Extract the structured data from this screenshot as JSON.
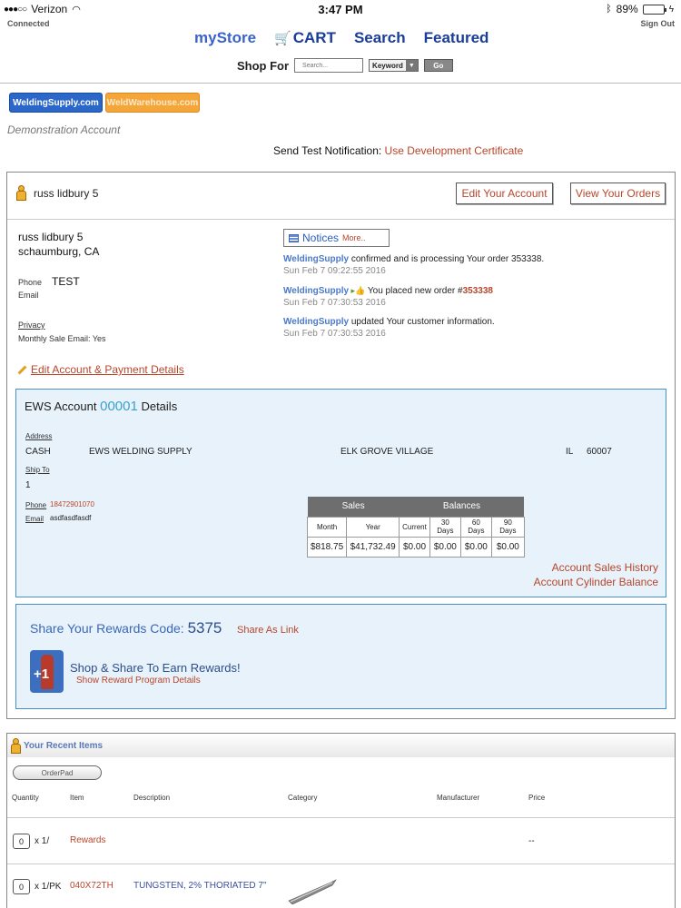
{
  "status": {
    "carrier": "Verizon",
    "time": "3:47 PM",
    "battery": "89%",
    "battery_level": 0.89
  },
  "header": {
    "connected": "Connected",
    "sign_out": "Sign Out",
    "nav": {
      "mystore": "myStore",
      "cart": "CART",
      "search": "Search",
      "featured": "Featured"
    },
    "shop_for": "Shop For",
    "search_placeholder": "Search...",
    "keyword": "Keyword",
    "go": "Go"
  },
  "stores": {
    "tab1": "WeldingSupply.com",
    "tab2": "WeldWarehouse.com"
  },
  "demo_account": "Demonstration Account",
  "send_test": {
    "label": "Send Test",
    "notification": "Notification:",
    "link": "Use Development Certificate"
  },
  "account": {
    "user_name": "russ lidbury 5",
    "edit_account": "Edit Your Account",
    "view_orders": "View Your Orders",
    "name": "russ lidbury 5",
    "location": "schaumburg, CA",
    "phone_label": "Phone",
    "phone_value": "TEST",
    "email_label": "Email",
    "privacy_label": "Privacy",
    "monthly_sale": "Monthly Sale Email: Yes",
    "edit_details": "Edit Account & Payment Details"
  },
  "notices": {
    "title": "Notices",
    "more": "More..",
    "items": [
      {
        "who": "WeldingSupply",
        "text": " confirmed and is processing Your order 353338.",
        "time": "Sun Feb 7 09:22:55 2016"
      },
      {
        "who": "WeldingSupply",
        "text": " You placed new order #",
        "order": "353338",
        "time": "Sun Feb 7 07:30:53 2016"
      },
      {
        "who": "WeldingSupply",
        "text": " updated Your customer information.",
        "time": "Sun Feb 7 07:30:53 2016"
      }
    ]
  },
  "ews": {
    "title_prefix": "EWS Account",
    "account_num": "00001",
    "title_suffix": "Details",
    "address_label": "Address",
    "address": {
      "col1": "CASH",
      "col2": "EWS WELDING SUPPLY",
      "city": "ELK GROVE VILLAGE",
      "state": "IL",
      "zip": "60007"
    },
    "ship_to_label": "Ship To",
    "ship_to_value": "1",
    "phone_label": "Phone",
    "phone_value": "18472901070",
    "email_label": "Email",
    "email_value": "asdfasdfasdf",
    "table": {
      "sales": "Sales",
      "balances": "Balances",
      "cols": [
        "Month",
        "Year",
        "Current",
        "30 Days",
        "60 Days",
        "90 Days"
      ],
      "values": [
        "$818.75",
        "$41,732.49",
        "$0.00",
        "$0.00",
        "$0.00",
        "$0.00"
      ]
    },
    "sales_history": "Account Sales History",
    "cylinder_balance": "Account Cylinder Balance"
  },
  "rewards": {
    "code_label": "Share Your Rewards Code:",
    "code": "5375",
    "share_link": "Share As Link",
    "badge": "+1",
    "earn": "Shop & Share To Earn Rewards!",
    "details": "Show Reward Program Details"
  },
  "recent": {
    "title": "Your Recent Items",
    "orderpad": "OrderPad",
    "cols": {
      "quantity": "Quantity",
      "item": "Item",
      "description": "Description",
      "category": "Category",
      "manufacturer": "Manufacturer",
      "price": "Price"
    },
    "rows": [
      {
        "qty": "0",
        "unit": "x 1/",
        "item": "Rewards",
        "description": "",
        "price": "--"
      },
      {
        "qty": "0",
        "unit": "x 1/PK",
        "item": "040X72TH",
        "description": "TUNGSTEN, 2% THORIATED 7\"",
        "price": ""
      }
    ]
  }
}
